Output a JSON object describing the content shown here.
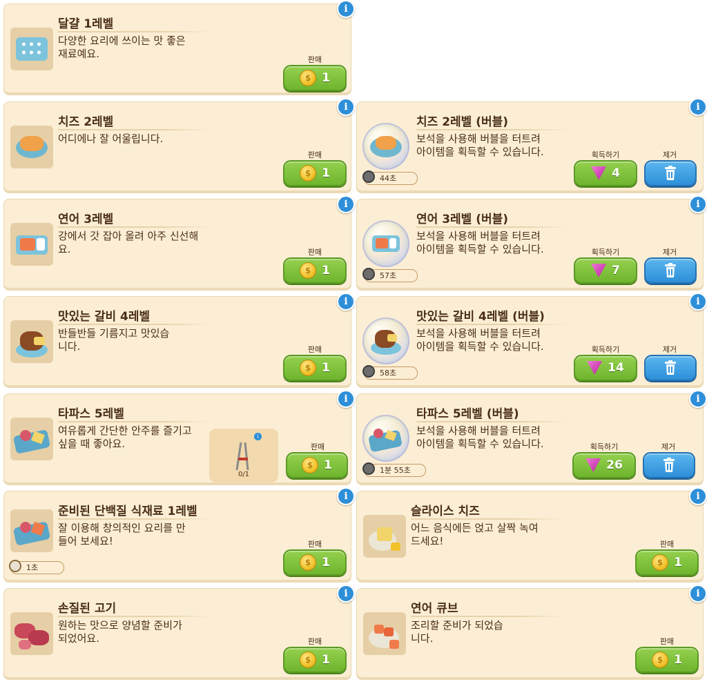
{
  "labels": {
    "sell": "판매",
    "acquire": "획득하기",
    "remove": "제거"
  },
  "icons": {
    "info": "i",
    "coin": "coin-icon",
    "gem": "gem-icon",
    "trash": "trash-icon",
    "timer": "timer-icon"
  },
  "colors": {
    "card_bg": "#fbeed4",
    "sell_button": "#7fc23a",
    "remove_button": "#3b9be0",
    "info_badge": "#2e8fd8",
    "gem": "#d94fc0"
  },
  "cards": [
    {
      "title": "달걀 1레벨",
      "desc": "다양한 요리에 쓰이는 맛 좋은 재료예요.",
      "price": "1"
    },
    {
      "title": "치즈 2레벨",
      "desc": "어디에나 잘 어울립니다.",
      "price": "1"
    },
    {
      "title": "치즈 2레벨 (버블)",
      "desc": "보석을 사용해 버블을 터트려 아이템을 획득할 수 있습니다.",
      "gems": "4",
      "timer": "44초"
    },
    {
      "title": "연어 3레벨",
      "desc": "강에서 갓 잡아 올려 아주 신선해요.",
      "price": "1"
    },
    {
      "title": "연어 3레벨 (버블)",
      "desc": "보석을 사용해 버블을 터트려 아이템을 획득할 수 있습니다.",
      "gems": "7",
      "timer": "57초"
    },
    {
      "title": "맛있는 갈비 4레벨",
      "desc": "반들반들 기름지고 맛있습니다.",
      "price": "1"
    },
    {
      "title": "맛있는 갈비 4레벨 (버블)",
      "desc": "보석을 사용해 버블을 터트려 아이템을 획득할 수 있습니다.",
      "gems": "14",
      "timer": "58초"
    },
    {
      "title": "타파스 5레벨",
      "desc": "여유롭게 간단한 안주를 즐기고 싶을 때 좋아요.",
      "price": "1",
      "tool_count": "0/1"
    },
    {
      "title": "타파스 5레벨 (버블)",
      "desc": "보석을 사용해 버블을 터트려 아이템을 획득할 수 있습니다.",
      "gems": "26",
      "timer": "1분 55초"
    },
    {
      "title": "준비된 단백질 식재료 1레벨",
      "desc": "잘 이용해 창의적인 요리를 만들어 보세요!",
      "price": "1",
      "timer": "1초"
    },
    {
      "title": "슬라이스 치즈",
      "desc": "어느 음식에든 얹고 살짝 녹여 드세요!",
      "price": "1"
    },
    {
      "title": "손질된 고기",
      "desc": "원하는 맛으로 양념할 준비가 되었어요.",
      "price": "1"
    },
    {
      "title": "연어 큐브",
      "desc": "조리할 준비가 되었습니다.",
      "price": "1"
    }
  ]
}
